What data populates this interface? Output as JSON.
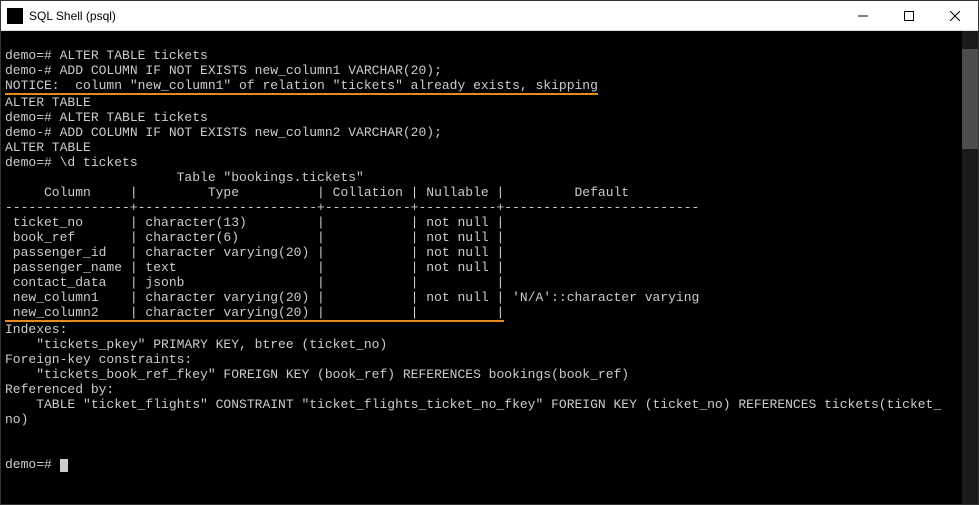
{
  "window": {
    "title": "SQL Shell (psql)"
  },
  "lines": {
    "l01": "demo=# ALTER TABLE tickets",
    "l02": "demo-# ADD COLUMN IF NOT EXISTS new_column1 VARCHAR(20);",
    "l03": "NOTICE:  column \"new_column1\" of relation \"tickets\" already exists, skipping",
    "l04": "ALTER TABLE",
    "l05": "demo=# ALTER TABLE tickets",
    "l06": "demo-# ADD COLUMN IF NOT EXISTS new_column2 VARCHAR(20);",
    "l07": "ALTER TABLE",
    "l08": "demo=# \\d tickets",
    "l09": "                      Table \"bookings.tickets\"",
    "l10": "     Column     |         Type          | Collation | Nullable |         Default",
    "l11": "----------------+-----------------------+-----------+----------+-------------------------",
    "l12": " ticket_no      | character(13)         |           | not null |",
    "l13": " book_ref       | character(6)          |           | not null |",
    "l14": " passenger_id   | character varying(20) |           | not null |",
    "l15": " passenger_name | text                  |           | not null |",
    "l16": " contact_data   | jsonb                 |           |          |",
    "l17": " new_column1    | character varying(20) |           | not null | 'N/A'::character varying",
    "l18": " new_column2    | character varying(20) |           |          |",
    "l19": "Indexes:",
    "l20": "    \"tickets_pkey\" PRIMARY KEY, btree (ticket_no)",
    "l21": "Foreign-key constraints:",
    "l22": "    \"tickets_book_ref_fkey\" FOREIGN KEY (book_ref) REFERENCES bookings(book_ref)",
    "l23": "Referenced by:",
    "l24": "    TABLE \"ticket_flights\" CONSTRAINT \"ticket_flights_ticket_no_fkey\" FOREIGN KEY (ticket_no) REFERENCES tickets(ticket_",
    "l25": "no)",
    "blank": "",
    "prompt": "demo=# "
  },
  "chart_data": {
    "type": "table",
    "title": "Table \"bookings.tickets\"",
    "columns": [
      "Column",
      "Type",
      "Collation",
      "Nullable",
      "Default"
    ],
    "rows": [
      {
        "Column": "ticket_no",
        "Type": "character(13)",
        "Collation": "",
        "Nullable": "not null",
        "Default": ""
      },
      {
        "Column": "book_ref",
        "Type": "character(6)",
        "Collation": "",
        "Nullable": "not null",
        "Default": ""
      },
      {
        "Column": "passenger_id",
        "Type": "character varying(20)",
        "Collation": "",
        "Nullable": "not null",
        "Default": ""
      },
      {
        "Column": "passenger_name",
        "Type": "text",
        "Collation": "",
        "Nullable": "not null",
        "Default": ""
      },
      {
        "Column": "contact_data",
        "Type": "jsonb",
        "Collation": "",
        "Nullable": "",
        "Default": ""
      },
      {
        "Column": "new_column1",
        "Type": "character varying(20)",
        "Collation": "",
        "Nullable": "not null",
        "Default": "'N/A'::character varying"
      },
      {
        "Column": "new_column2",
        "Type": "character varying(20)",
        "Collation": "",
        "Nullable": "",
        "Default": ""
      }
    ],
    "indexes": [
      "\"tickets_pkey\" PRIMARY KEY, btree (ticket_no)"
    ],
    "foreign_keys": [
      "\"tickets_book_ref_fkey\" FOREIGN KEY (book_ref) REFERENCES bookings(book_ref)"
    ],
    "referenced_by": [
      "TABLE \"ticket_flights\" CONSTRAINT \"ticket_flights_ticket_no_fkey\" FOREIGN KEY (ticket_no) REFERENCES tickets(ticket_no)"
    ]
  }
}
